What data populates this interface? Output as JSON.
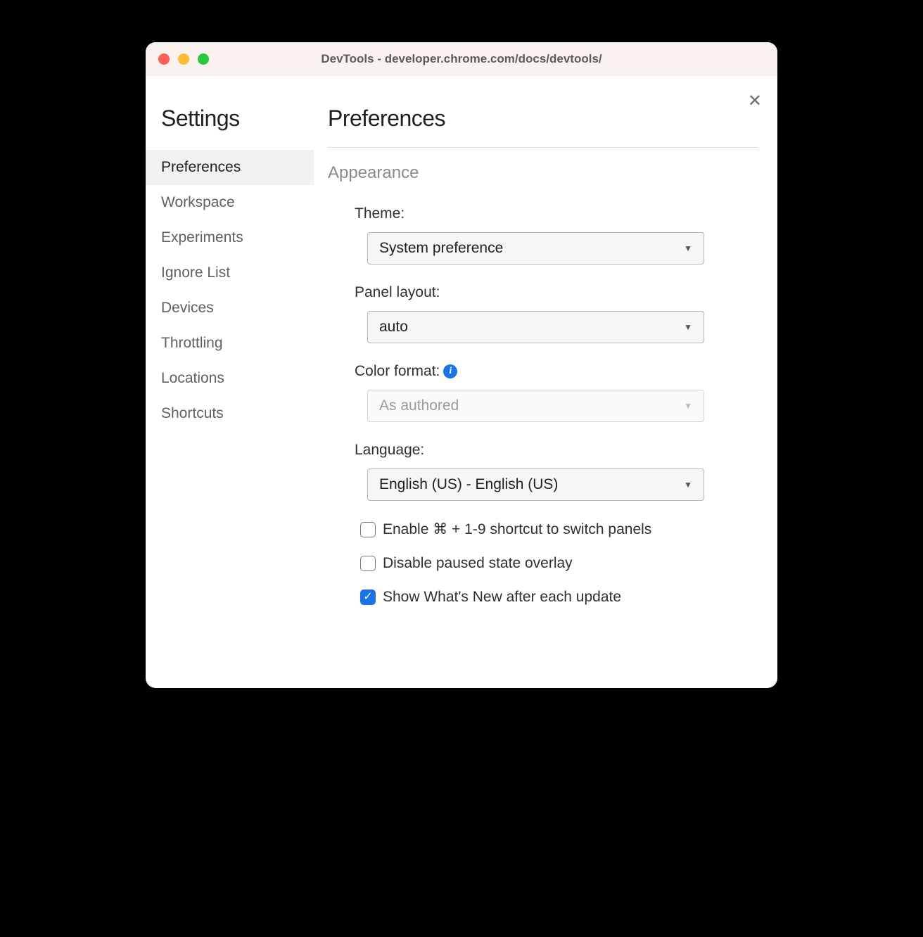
{
  "window": {
    "title": "DevTools - developer.chrome.com/docs/devtools/"
  },
  "sidebar": {
    "title": "Settings",
    "items": [
      {
        "label": "Preferences",
        "active": true
      },
      {
        "label": "Workspace",
        "active": false
      },
      {
        "label": "Experiments",
        "active": false
      },
      {
        "label": "Ignore List",
        "active": false
      },
      {
        "label": "Devices",
        "active": false
      },
      {
        "label": "Throttling",
        "active": false
      },
      {
        "label": "Locations",
        "active": false
      },
      {
        "label": "Shortcuts",
        "active": false
      }
    ]
  },
  "main": {
    "title": "Preferences",
    "section": "Appearance",
    "fields": {
      "theme": {
        "label": "Theme:",
        "value": "System preference"
      },
      "panel_layout": {
        "label": "Panel layout:",
        "value": "auto"
      },
      "color_format": {
        "label": "Color format:",
        "value": "As authored",
        "disabled": true,
        "has_info": true
      },
      "language": {
        "label": "Language:",
        "value": "English (US) - English (US)"
      }
    },
    "checkboxes": [
      {
        "label": "Enable ⌘ + 1-9 shortcut to switch panels",
        "checked": false
      },
      {
        "label": "Disable paused state overlay",
        "checked": false
      },
      {
        "label": "Show What's New after each update",
        "checked": true
      }
    ]
  }
}
